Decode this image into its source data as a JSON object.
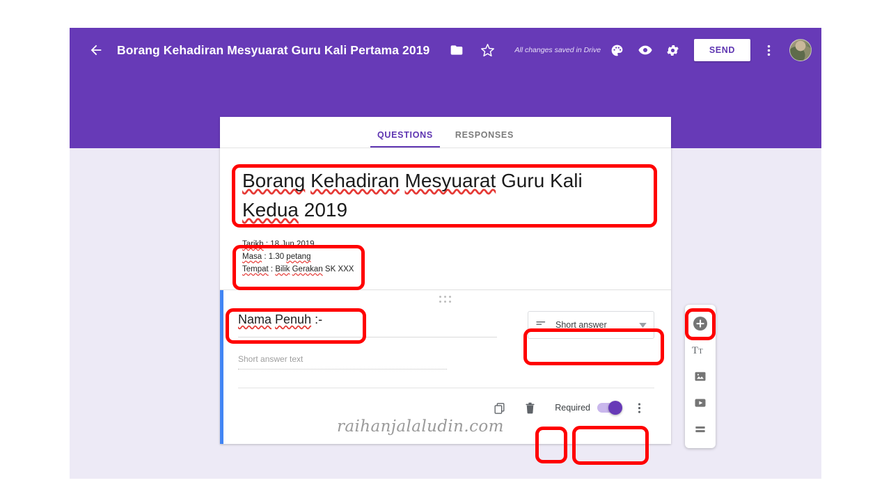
{
  "header": {
    "back_icon": "back-arrow-icon",
    "doc_title": "Borang Kehadiran Mesyuarat Guru Kali Pertama 2019",
    "folder_icon": "folder-icon",
    "star_icon": "star-icon",
    "save_status": "All changes saved in Drive",
    "palette_icon": "palette-icon",
    "preview_icon": "eye-preview-icon",
    "settings_icon": "gear-icon",
    "send_label": "SEND",
    "more_icon": "kebab-menu-icon",
    "avatar": "user-avatar"
  },
  "tabs": [
    {
      "label": "QUESTIONS",
      "active": true
    },
    {
      "label": "RESPONSES",
      "active": false
    }
  ],
  "form": {
    "title_parts": [
      {
        "text": "Borang",
        "spell": true
      },
      {
        "text": " ",
        "spell": false
      },
      {
        "text": "Kehadiran",
        "spell": true
      },
      {
        "text": " ",
        "spell": false
      },
      {
        "text": "Mesyuarat",
        "spell": true
      },
      {
        "text": " Guru Kali ",
        "spell": false
      },
      {
        "text": "Kedua",
        "spell": true
      },
      {
        "text": " 2019",
        "spell": false
      }
    ],
    "title_plain": "Borang Kehadiran Mesyuarat Guru Kali Kedua 2019",
    "description_lines": [
      [
        {
          "text": "Tarikh",
          "spell": true
        },
        {
          "text": " : 18 Jun 2019",
          "spell": false
        }
      ],
      [
        {
          "text": "Masa",
          "spell": true
        },
        {
          "text": " : 1.30 ",
          "spell": false
        },
        {
          "text": "petang",
          "spell": true
        }
      ],
      [
        {
          "text": "Tempat",
          "spell": true
        },
        {
          "text": " : ",
          "spell": false
        },
        {
          "text": "Bilik",
          "spell": true
        },
        {
          "text": " ",
          "spell": false
        },
        {
          "text": "Gerakan",
          "spell": true
        },
        {
          "text": " SK XXX",
          "spell": false
        }
      ]
    ],
    "description_plain": "Tarikh : 18 Jun 2019\nMasa : 1.30 petang\nTempat : Bilik Gerakan SK XXX"
  },
  "question": {
    "drag_handle_icon": "drag-handle-icon",
    "title_parts": [
      {
        "text": "Nama",
        "spell": true
      },
      {
        "text": " ",
        "spell": false
      },
      {
        "text": "Penuh",
        "spell": true
      },
      {
        "text": " :-",
        "spell": false
      }
    ],
    "title_plain": "Nama Penuh :-",
    "type_icon": "short-answer-icon",
    "type_label": "Short answer",
    "type_dropdown_icon": "chevron-down-icon",
    "answer_placeholder": "Short answer text",
    "duplicate_icon": "duplicate-icon",
    "delete_icon": "trash-icon",
    "required_label": "Required",
    "required_on": true,
    "more_icon": "kebab-menu-icon"
  },
  "side_toolbar": [
    {
      "icon": "add-question-icon",
      "name": "add-question-button",
      "highlighted": true
    },
    {
      "icon": "add-title-icon",
      "name": "add-title-button",
      "highlighted": false
    },
    {
      "icon": "add-image-icon",
      "name": "add-image-button",
      "highlighted": false
    },
    {
      "icon": "add-video-icon",
      "name": "add-video-button",
      "highlighted": false
    },
    {
      "icon": "add-section-icon",
      "name": "add-section-button",
      "highlighted": false
    }
  ],
  "watermark": {
    "text": "raihanjalaludin.com"
  },
  "colors": {
    "brand_purple": "#673AB7",
    "accent_purple": "#5E35B1",
    "page_background": "#EDEAF6",
    "annotation_red": "#FF0000",
    "question_accent_blue": "#4285F4",
    "spellcheck_red": "#E53935"
  },
  "annotations": [
    {
      "name": "annotation-form-title"
    },
    {
      "name": "annotation-form-description"
    },
    {
      "name": "annotation-question-title"
    },
    {
      "name": "annotation-question-type"
    },
    {
      "name": "annotation-delete-button"
    },
    {
      "name": "annotation-required-toggle"
    },
    {
      "name": "annotation-add-question"
    }
  ]
}
